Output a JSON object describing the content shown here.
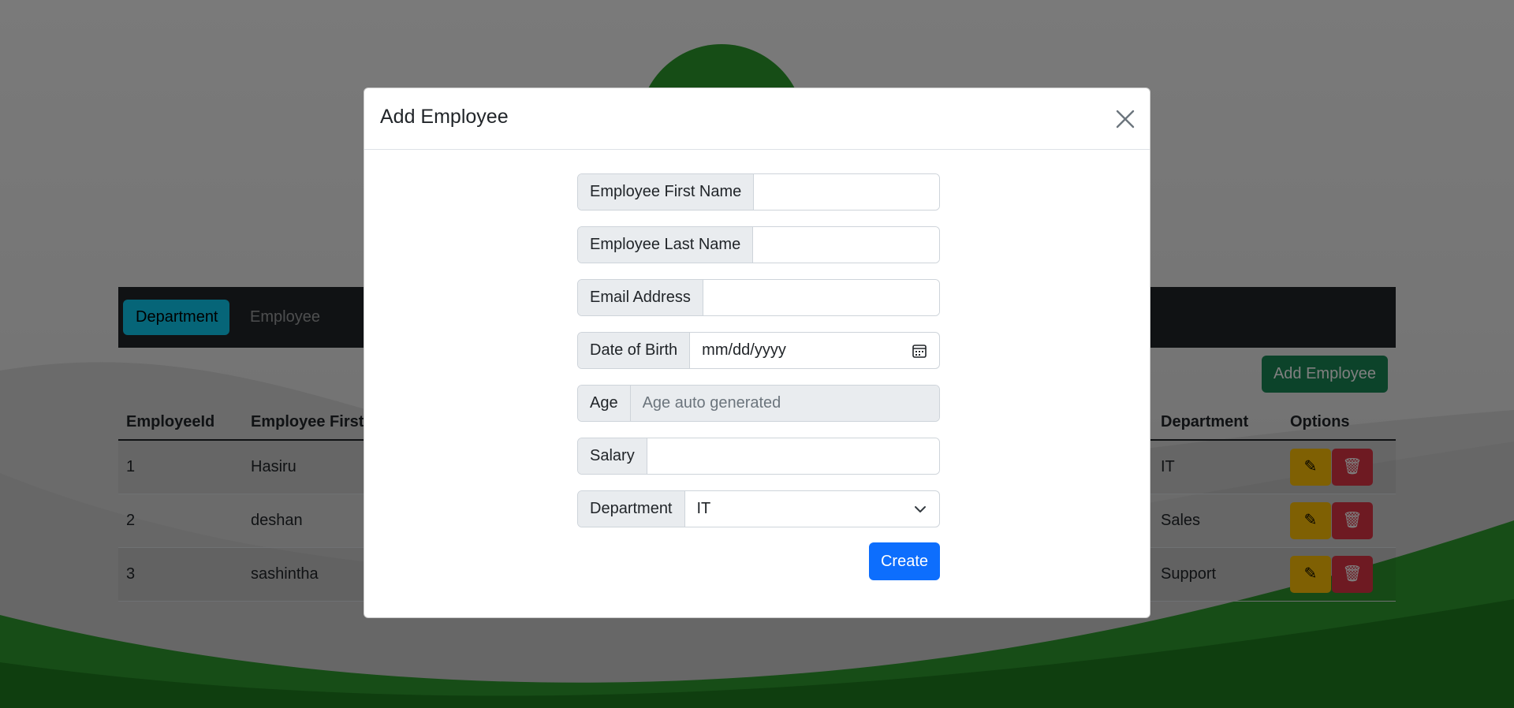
{
  "nav": {
    "items": [
      {
        "label": "Department",
        "active": true
      },
      {
        "label": "Employee",
        "active": false
      }
    ]
  },
  "page": {
    "add_button_label": "Add Employee"
  },
  "table": {
    "headers": [
      "EmployeeId",
      "Employee First",
      "Department",
      "Options"
    ],
    "rows": [
      {
        "id": "1",
        "first": "Hasiru",
        "department": "IT"
      },
      {
        "id": "2",
        "first": "deshan",
        "department": "Sales"
      },
      {
        "id": "3",
        "first": "sashintha",
        "department": "Support"
      }
    ]
  },
  "modal": {
    "title": "Add Employee",
    "fields": {
      "first_name_label": "Employee First Name",
      "last_name_label": "Employee Last Name",
      "email_label": "Email Address",
      "dob_label": "Date of Birth",
      "dob_placeholder": "mm/dd/yyyy",
      "age_label": "Age",
      "age_placeholder": "Age auto generated",
      "salary_label": "Salary",
      "department_label": "Department",
      "department_value": "IT"
    },
    "create_label": "Create"
  },
  "colors": {
    "nav_bg": "#212529",
    "nav_active": "#0dcaf0",
    "add_button": "#198754",
    "primary": "#0d6efd",
    "edit": "#ffc107",
    "delete": "#dc3545",
    "logo": "#2c9a2c"
  },
  "icons": {
    "close": "close-icon",
    "calendar": "calendar-icon",
    "chevron": "chevron-down-icon",
    "edit": "edit-icon",
    "delete": "trash-icon"
  }
}
